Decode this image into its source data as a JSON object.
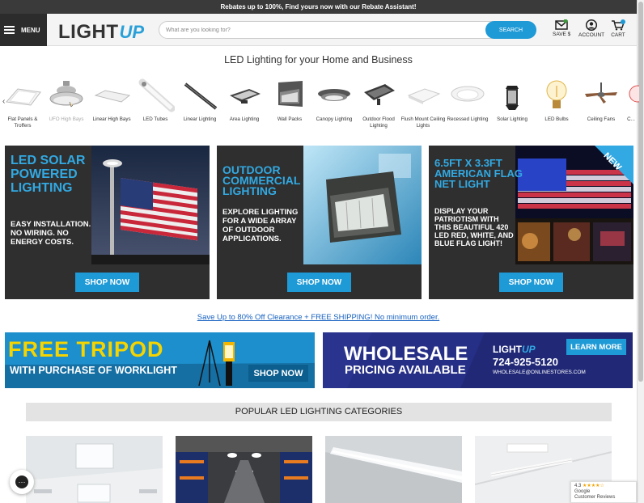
{
  "topbar": {
    "text": "Rebates up to 100%, Find yours now with our Rebate Assistant!"
  },
  "header": {
    "menu_label": "MENU",
    "logo_light": "LIGHT",
    "logo_up": "UP",
    "search_placeholder": "What are you looking for?",
    "search_button": "SEARCH",
    "save_label": "SAVE $",
    "account_label": "ACCOUNT",
    "cart_label": "CART",
    "cart_count": "0"
  },
  "tagline": "LED Lighting for your Home and Business",
  "categories": [
    {
      "label": "Flat Panels & Troffers"
    },
    {
      "label": "UFO High Bays"
    },
    {
      "label": "Linear High Bays"
    },
    {
      "label": "LED Tubes"
    },
    {
      "label": "Linear Lighting"
    },
    {
      "label": "Area Lighting"
    },
    {
      "label": "Wall Packs"
    },
    {
      "label": "Canopy Lighting"
    },
    {
      "label": "Outdoor Flood Lighting"
    },
    {
      "label": "Flush Mount Ceiling Lights"
    },
    {
      "label": "Recessed Lighting"
    },
    {
      "label": "Solar Lighting"
    },
    {
      "label": "LED Bulbs"
    },
    {
      "label": "Ceiling Fans"
    },
    {
      "label": "C..."
    }
  ],
  "promos": [
    {
      "headline": "LED SOLAR POWERED LIGHTING",
      "sub": "EASY INSTALLATION. NO WIRING. NO ENERGY COSTS.",
      "button": "SHOP NOW"
    },
    {
      "headline": "OUTDOOR COMMERCIAL LIGHTING",
      "sub": "EXPLORE LIGHTING FOR A WIDE ARRAY OF OUTDOOR APPLICATIONS.",
      "button": "SHOP NOW"
    },
    {
      "headline": "6.5FT X 3.3FT AMERICAN FLAG NET LIGHT",
      "sub": "DISPLAY YOUR PATRIOTISM WITH THIS BEAUTIFUL 420 LED RED, WHITE, AND BLUE FLAG LIGHT!",
      "button": "SHOP NOW",
      "badge": "NEW"
    }
  ],
  "clearance_link": "Save Up to 80% Off Clearance + FREE SHIPPING! No minimum order.",
  "banners": {
    "tripod_title": "FREE TRIPOD",
    "tripod_sub": "WITH PURCHASE OF WORKLIGHT",
    "tripod_button": "SHOP NOW",
    "wholesale_title": "WHOLESALE",
    "wholesale_sub": "PRICING AVAILABLE",
    "wholesale_logo_light": "LIGHT",
    "wholesale_logo_up": "UP",
    "wholesale_phone": "724-925-5120",
    "wholesale_email": "WHOLESALE@ONLINESTORES.COM",
    "wholesale_button": "LEARN MORE"
  },
  "popular_header": "POPULAR LED LIGHTING CATEGORIES",
  "google_review": {
    "rating": "4.3",
    "stars": "★★★★☆",
    "line1": "Google",
    "line2": "Customer Reviews"
  },
  "colors": {
    "accent": "#1e9ad6",
    "dark": "#2f2f2f",
    "headline_blue": "#32a9e2"
  }
}
